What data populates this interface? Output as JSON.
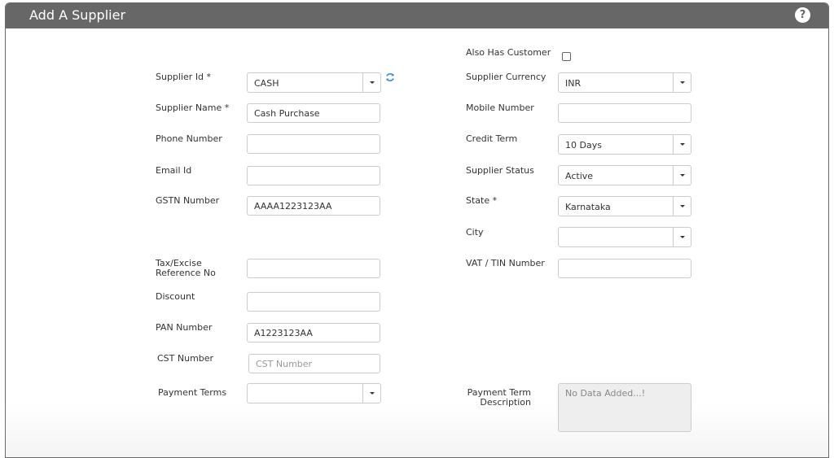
{
  "header": {
    "title": "Add A Supplier",
    "help_icon": "question-circle-icon"
  },
  "left_fields": {
    "supplier_id": {
      "label": "Supplier Id *",
      "value": "CASH",
      "refresh_icon": "refresh-icon"
    },
    "supplier_name": {
      "label": "Supplier Name *",
      "value": "Cash Purchase"
    },
    "phone_number": {
      "label": "Phone Number",
      "value": ""
    },
    "email_id": {
      "label": "Email Id",
      "value": ""
    },
    "gstn_number": {
      "label": "GSTN Number",
      "value": "AAAA1223123AA"
    },
    "tax_excise_ref": {
      "label_line1": "Tax/Excise",
      "label_line2": "Reference No",
      "value": ""
    },
    "discount": {
      "label": "Discount",
      "value": ""
    },
    "pan_number": {
      "label": "PAN Number",
      "value": "A1223123AA"
    },
    "cst_number": {
      "label": "CST Number",
      "value": "",
      "placeholder": "CST Number"
    },
    "payment_terms": {
      "label": "Payment Terms",
      "value": ""
    }
  },
  "right_fields": {
    "also_has_customer": {
      "label": "Also Has Customer",
      "checked": false
    },
    "supplier_currency": {
      "label": "Supplier Currency",
      "value": "INR"
    },
    "mobile_number": {
      "label": "Mobile Number",
      "value": ""
    },
    "credit_term": {
      "label": "Credit Term",
      "value": "10 Days"
    },
    "supplier_status": {
      "label": "Supplier Status",
      "value": "Active"
    },
    "state": {
      "label": "State *",
      "value": "Karnataka"
    },
    "city": {
      "label": "City",
      "value": ""
    },
    "vat_tin_number": {
      "label": "VAT / TIN Number",
      "value": ""
    },
    "payment_term_description": {
      "label_line1": "Payment Term",
      "label_line2": "Description",
      "value": "No Data Added...!"
    }
  }
}
